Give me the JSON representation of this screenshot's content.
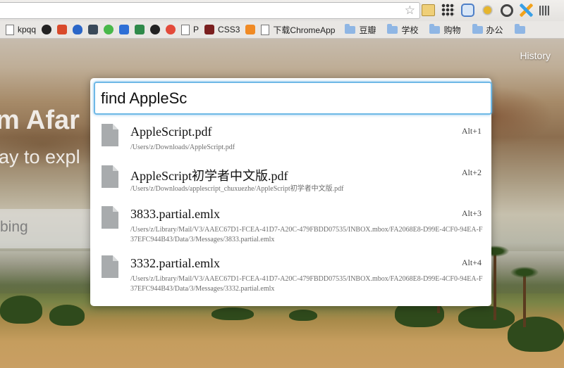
{
  "bookmarks": [
    {
      "label": "kpqq",
      "icon": "page-icon"
    },
    {
      "label": "",
      "icon": "github-icon"
    },
    {
      "label": "",
      "icon": "red-f-icon"
    },
    {
      "label": "",
      "icon": "flame-icon"
    },
    {
      "label": "",
      "icon": "fx-icon"
    },
    {
      "label": "",
      "icon": "wechat-icon"
    },
    {
      "label": "",
      "icon": "w-icon"
    },
    {
      "label": "",
      "icon": "plant-icon"
    },
    {
      "label": "",
      "icon": "panda-icon"
    },
    {
      "label": "",
      "icon": "weibo-icon"
    },
    {
      "label": "P",
      "icon": "page-icon"
    },
    {
      "label": "CSS3",
      "icon": "cursor-icon"
    },
    {
      "label": "",
      "icon": "stack-icon"
    },
    {
      "label": "下载ChromeApp",
      "icon": "page-icon"
    },
    {
      "label": "豆瓣",
      "icon": "folder-icon"
    },
    {
      "label": "学校",
      "icon": "folder-icon"
    },
    {
      "label": "购物",
      "icon": "folder-icon"
    },
    {
      "label": "办公",
      "icon": "folder-icon"
    },
    {
      "label": "",
      "icon": "folder-icon"
    }
  ],
  "page": {
    "history_link": "History",
    "hero_title": "m Afar",
    "hero_sub": "ay to expl",
    "search_placeholder": "bing"
  },
  "launcher": {
    "query": "find AppleSc",
    "results": [
      {
        "title": "AppleScript.pdf",
        "path": "/Users/z/Downloads/AppleScript.pdf",
        "shortcut": "Alt+1"
      },
      {
        "title": "AppleScript初学者中文版.pdf",
        "path": "/Users/z/Downloads/applescript_chuxuezhe/AppleScript初学者中文版.pdf",
        "shortcut": "Alt+2"
      },
      {
        "title": "3833.partial.emlx",
        "path": "/Users/z/Library/Mail/V3/AAEC67D1-FCEA-41D7-A20C-479FBDD07535/INBOX.mbox/FA2068E8-D99E-4CF0-94EA-F37EFC944B43/Data/3/Messages/3833.partial.emlx",
        "shortcut": "Alt+3"
      },
      {
        "title": "3332.partial.emlx",
        "path": "/Users/z/Library/Mail/V3/AAEC67D1-FCEA-41D7-A20C-479FBDD07535/INBOX.mbox/FA2068E8-D99E-4CF0-94EA-F37EFC944B43/Data/3/Messages/3332.partial.emlx",
        "shortcut": "Alt+4"
      }
    ]
  }
}
